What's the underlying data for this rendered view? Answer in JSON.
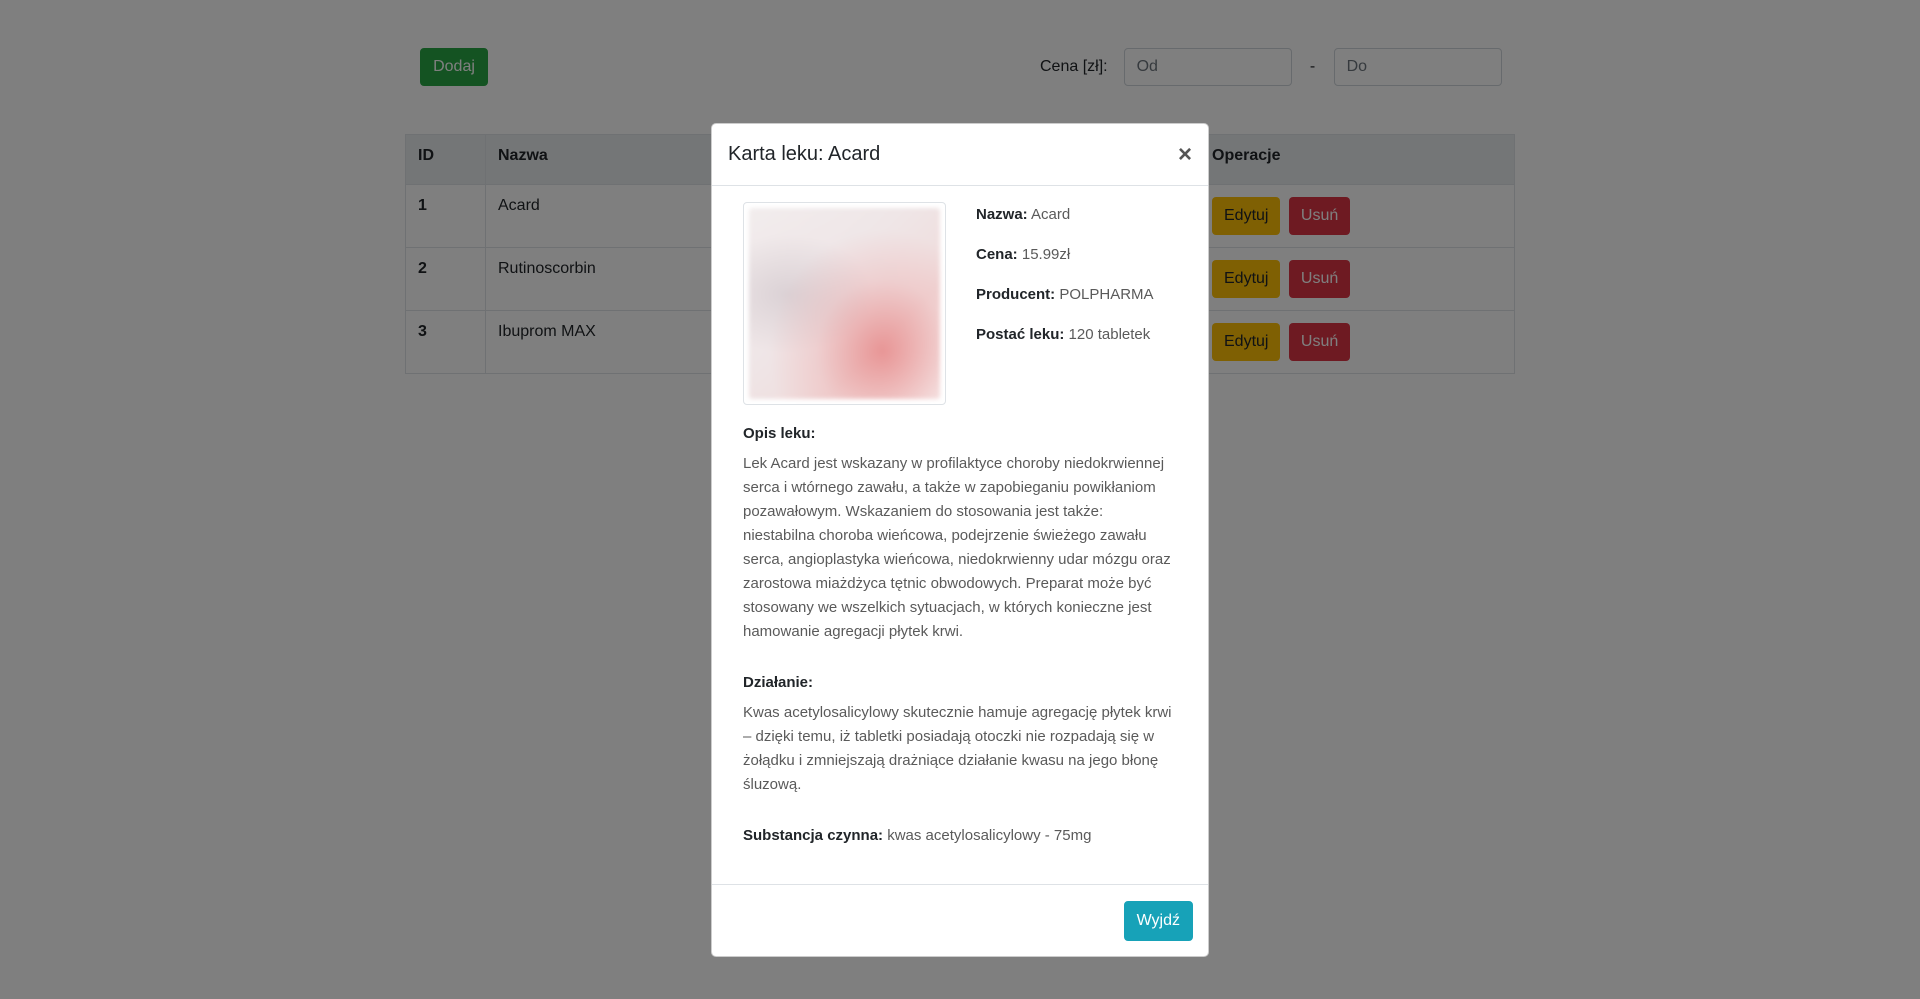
{
  "toolbar": {
    "add_label": "Dodaj",
    "price_label": "Cena [zł]:",
    "price_from_placeholder": "Od",
    "price_to_placeholder": "Do",
    "dash": "-"
  },
  "table": {
    "headers": [
      "ID",
      "Nazwa",
      "Operacje"
    ],
    "rows": [
      {
        "id": "1",
        "name": "Acard",
        "edit": "Edytuj",
        "delete": "Usuń"
      },
      {
        "id": "2",
        "name": "Rutinoscorbin",
        "edit": "Edytuj",
        "delete": "Usuń"
      },
      {
        "id": "3",
        "name": "Ibuprom MAX",
        "edit": "Edytuj",
        "delete": "Usuń"
      }
    ]
  },
  "modal": {
    "title": "Karta leku: Acard",
    "close": "×",
    "fields": {
      "name_label": "Nazwa:",
      "name_value": "Acard",
      "price_label": "Cena:",
      "price_value": "15.99zł",
      "producer_label": "Producent:",
      "producer_value": "POLPHARMA",
      "form_label": "Postać leku:",
      "form_value": "120 tabletek"
    },
    "description_title": "Opis leku:",
    "description_text": "Lek Acard jest wskazany w profilaktyce choroby niedokrwiennej serca i wtórnego zawału, a także w zapobieganiu powikłaniom pozawałowym. Wskazaniem do stosowania jest także: niestabilna choroba wieńcowa, podejrzenie świeżego zawału serca, angioplastyka wieńcowa, niedokrwienny udar mózgu oraz zarostowa miażdżyca tętnic obwodowych. Preparat może być stosowany we wszelkich sytuacjach, w których konieczne jest hamowanie agregacji płytek krwi.",
    "action_title": "Działanie:",
    "action_text": "Kwas acetylosalicylowy skutecznie hamuje agregację płytek krwi – dzięki temu, iż tabletki posiadają otoczki nie rozpadają się w żołądku i zmniejszają drażniące działanie kwasu na jego błonę śluzową.",
    "substance_label": "Substancja czynna:",
    "substance_value": "kwas acetylosalicylowy - 75mg",
    "exit_label": "Wyjdź"
  },
  "colors": {
    "success": "#28a745",
    "warning": "#ffc107",
    "danger": "#dc3545",
    "info": "#17a2b8"
  }
}
